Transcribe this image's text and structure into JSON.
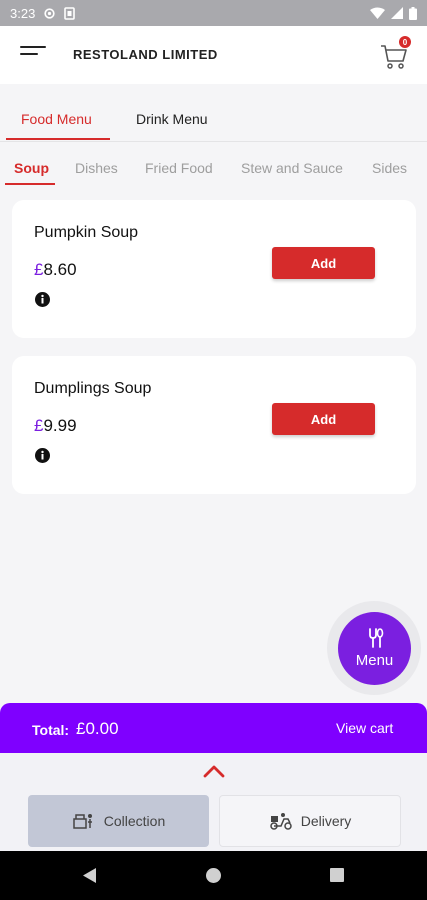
{
  "status_bar": {
    "time": "3:23",
    "icons": [
      "settings-icon",
      "sim-icon",
      "wifi-icon",
      "signal-icon",
      "battery-icon"
    ]
  },
  "app_bar": {
    "title": "RESTOLAND LIMITED",
    "cart_count": "0",
    "icons": [
      "hamburger-menu-icon",
      "cart-icon"
    ]
  },
  "menu_tabs": [
    "Food Menu",
    "Drink Menu"
  ],
  "category_tabs": [
    "Soup",
    "Dishes",
    "Fried Food",
    "Stew and Sauce",
    "Sides"
  ],
  "items": [
    {
      "name": "Pumpkin Soup",
      "currency": "£",
      "price": "8.60",
      "add_label": "Add"
    },
    {
      "name": "Dumplings Soup",
      "currency": "£",
      "price": "9.99",
      "add_label": "Add"
    }
  ],
  "fab": {
    "label": "Menu",
    "icon": "fork-spoon-icon"
  },
  "total_bar": {
    "label": "Total:",
    "value": "£0.00",
    "view_cart": "View cart"
  },
  "order_modes": [
    {
      "label": "Collection",
      "icon": "collection-icon",
      "selected": true
    },
    {
      "label": "Delivery",
      "icon": "delivery-icon",
      "selected": false
    }
  ],
  "colors": {
    "accent_red": "#d62b2b",
    "brand_purple": "#7f00ff",
    "fab_purple": "#7b1fe0"
  }
}
